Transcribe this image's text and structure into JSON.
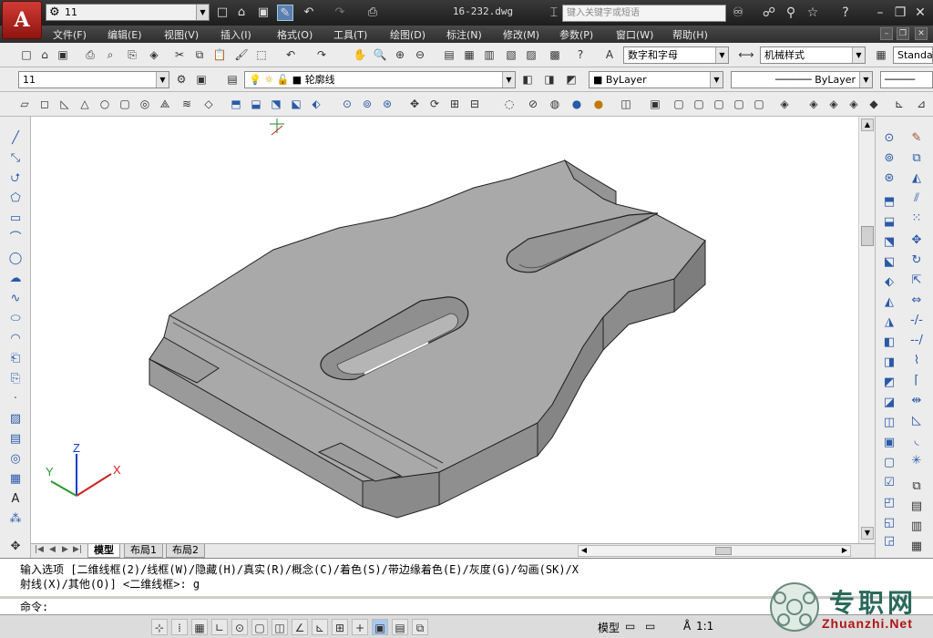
{
  "window": {
    "app_logo": "A",
    "workspace": "11",
    "doc_title": "16-232.dwg",
    "search_placeholder": "键入关键字或短语"
  },
  "menu": [
    "文件(F)",
    "编辑(E)",
    "视图(V)",
    "插入(I)",
    "格式(O)",
    "工具(T)",
    "绘图(D)",
    "标注(N)",
    "修改(M)",
    "参数(P)",
    "窗口(W)",
    "帮助(H)"
  ],
  "toolbar_styles": {
    "text_style": "数字和字母",
    "dim_style": "机械样式",
    "table_style": "Standa"
  },
  "toolbar_layers": {
    "layer_state": "11",
    "current_layer": "轮廓线",
    "color": "ByLayer",
    "linetype": "ByLayer"
  },
  "tabs": [
    "模型",
    "布局1",
    "布局2"
  ],
  "ucs": {
    "x": "X",
    "y": "Y",
    "z": "Z"
  },
  "command": {
    "line1": "输入选项 [二维线框(2)/线框(W)/隐藏(H)/真实(R)/概念(C)/着色(S)/带边缘着色(E)/灰度(G)/勾画(SK)/X",
    "line2": "射线(X)/其他(O)] <二维线框>: g",
    "prompt": "命令:"
  },
  "status": {
    "model": "模型",
    "scale": "1:1"
  },
  "watermark": {
    "name": "专职网",
    "url": "Zhuanzhi.Net"
  },
  "colors": {
    "title_bg": "#2a2a2a",
    "app_red": "#c0271f",
    "canvas_bg": "#ffffff",
    "solid_gray": "#a9a9a9"
  }
}
